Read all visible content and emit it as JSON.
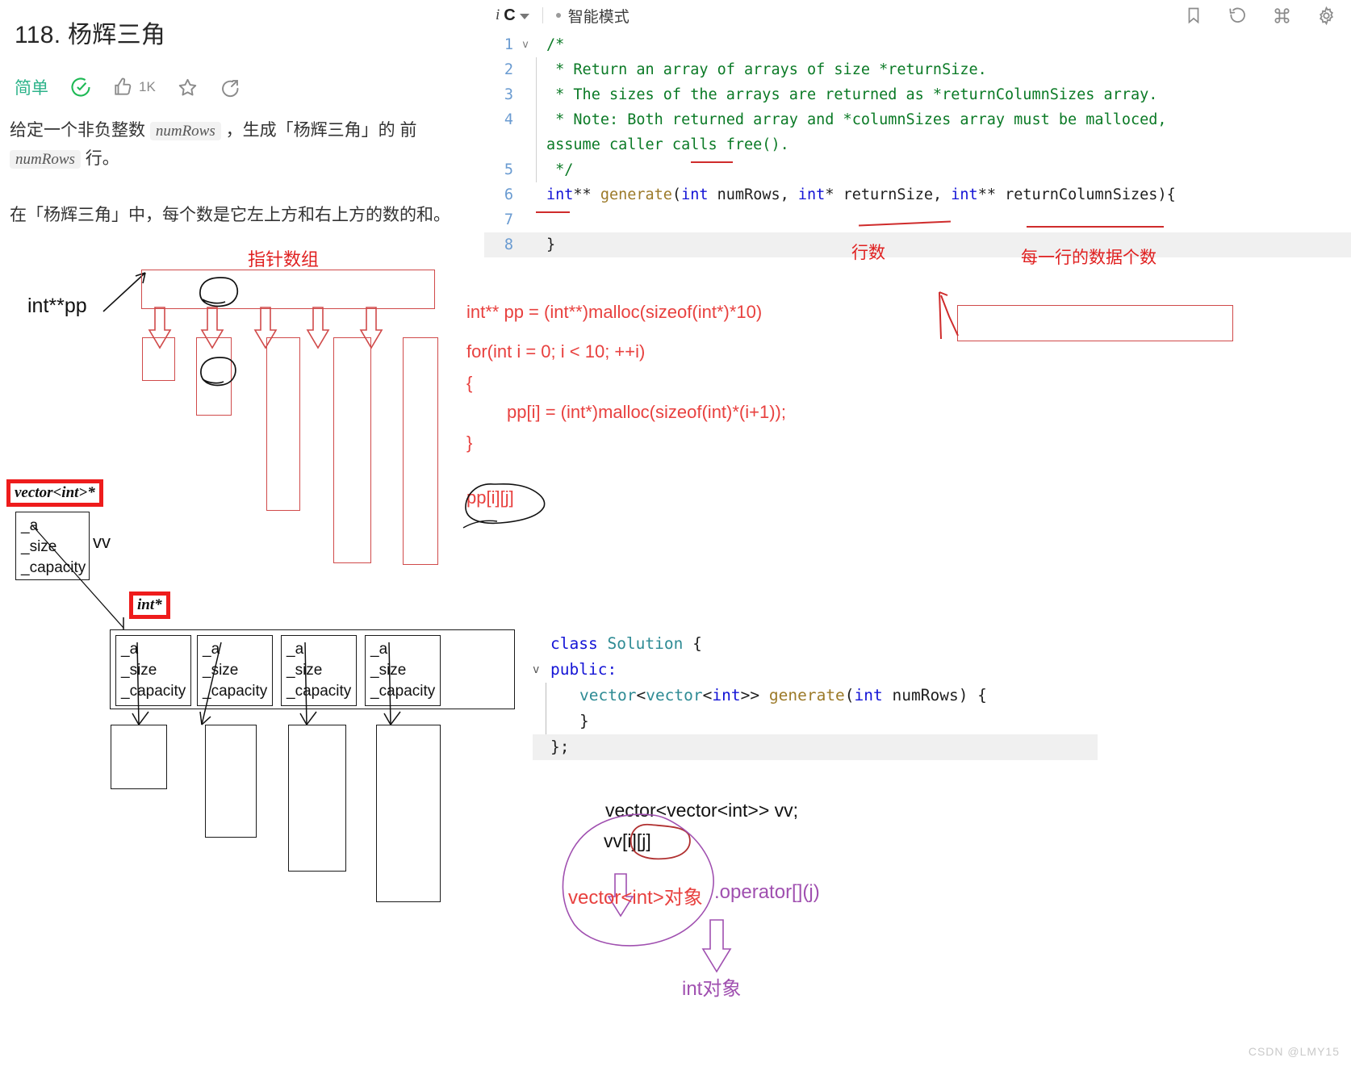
{
  "problem": {
    "title": "118. 杨辉三角",
    "difficulty": "简单",
    "solved_icon": "check-circle-icon",
    "like_icon": "thumbs-up-icon",
    "like_count": "1K",
    "star_icon": "star-icon",
    "share_icon": "share-icon",
    "desc_line1_a": "给定一个非负整数",
    "desc_chip1": "numRows",
    "desc_line1_b": "，生成「杨辉三角」的",
    "desc_line2_a": "前",
    "desc_chip2": "numRows",
    "desc_line2_b": "行。",
    "desc_para2": "在「杨辉三角」中，每个数是它左上方和右上方的数的和。"
  },
  "editor": {
    "lang_prefix": "i",
    "lang_name": "C",
    "chevron_icon": "chevron-down-icon",
    "smart_mode_label": "智能模式",
    "bookmark_icon": "bookmark-icon",
    "reset_icon": "reset-icon",
    "command_icon": "command-icon",
    "settings_icon": "gear-icon",
    "lines": [
      {
        "no": "1",
        "fold": "v",
        "segments": [
          {
            "t": "/*",
            "c": "cmt"
          }
        ]
      },
      {
        "no": "2",
        "fold": "",
        "segments": [
          {
            "t": " * Return an array of arrays of size *returnSize.",
            "c": "cmt"
          }
        ]
      },
      {
        "no": "3",
        "fold": "",
        "segments": [
          {
            "t": " * The sizes of the arrays are returned as *returnColumnSizes array.",
            "c": "cmt"
          }
        ]
      },
      {
        "no": "4",
        "fold": "",
        "segments": [
          {
            "t": " * Note: Both returned array and *columnSizes array must be malloced,",
            "c": "cmt"
          }
        ]
      },
      {
        "no": "",
        "fold": "",
        "segments": [
          {
            "t": "assume caller calls free().",
            "c": "cmt"
          }
        ]
      },
      {
        "no": "5",
        "fold": "",
        "segments": [
          {
            "t": " */",
            "c": "cmt"
          }
        ]
      },
      {
        "no": "6",
        "fold": "",
        "segments": [
          {
            "t": "int",
            "c": "kw"
          },
          {
            "t": "** ",
            "c": "pl"
          },
          {
            "t": "generate",
            "c": "fn"
          },
          {
            "t": "(",
            "c": "pl"
          },
          {
            "t": "int",
            "c": "kw"
          },
          {
            "t": " numRows, ",
            "c": "pl"
          },
          {
            "t": "int",
            "c": "kw"
          },
          {
            "t": "* returnSize, ",
            "c": "pl"
          },
          {
            "t": "int",
            "c": "kw"
          },
          {
            "t": "** returnColumnSizes){",
            "c": "pl"
          }
        ]
      },
      {
        "no": "7",
        "fold": "",
        "segments": [
          {
            "t": "",
            "c": "pl"
          }
        ]
      },
      {
        "no": "8",
        "fold": "",
        "segments": [
          {
            "t": "}",
            "c": "pl"
          }
        ]
      }
    ]
  },
  "annotations": {
    "pointer_array_label": "指针数组",
    "int_pp_label": "int**pp",
    "row_count_label": "行数",
    "per_row_count_label": "每一行的数据个数",
    "vector_int_ptr_tag": "vector<int>*",
    "int_ptr_tag": "int*",
    "vv_label": "vv",
    "struct_fields": [
      "_a",
      "_size",
      "_capacity"
    ],
    "malloc_code": [
      "int** pp = (int**)malloc(sizeof(int*)*10)",
      "for(int i = 0; i < 10; ++i)",
      "{",
      "pp[i] = (int*)malloc(sizeof(int)*(i+1));",
      "}"
    ],
    "pp_index_label": "pp[i][j]",
    "vv_decl": "vector<vector<int>>  vv;",
    "vv_index_label": "vv[i][j]",
    "vector_obj_label": "vector<int>对象",
    "operator_label": ".operator[](j)",
    "int_obj_label": "int对象"
  },
  "cpp_code": {
    "lines": [
      {
        "fold": "",
        "indent": 0,
        "segments": [
          {
            "t": "class ",
            "c": "kw"
          },
          {
            "t": "Solution",
            "c": "cls"
          },
          {
            "t": " {",
            "c": "pl"
          }
        ]
      },
      {
        "fold": "v",
        "indent": 0,
        "segments": [
          {
            "t": "public:",
            "c": "kw"
          }
        ]
      },
      {
        "fold": "",
        "indent": 1,
        "segments": [
          {
            "t": "vector",
            "c": "cls"
          },
          {
            "t": "<",
            "c": "pl"
          },
          {
            "t": "vector",
            "c": "cls"
          },
          {
            "t": "<",
            "c": "pl"
          },
          {
            "t": "int",
            "c": "kw"
          },
          {
            "t": ">> ",
            "c": "pl"
          },
          {
            "t": "generate",
            "c": "fn"
          },
          {
            "t": "(",
            "c": "pl"
          },
          {
            "t": "int",
            "c": "kw"
          },
          {
            "t": " numRows",
            "c": "pl"
          },
          {
            "t": ") {",
            "c": "pl"
          }
        ]
      },
      {
        "fold": "",
        "indent": 0,
        "segments": [
          {
            "t": "",
            "c": "pl"
          }
        ]
      },
      {
        "fold": "",
        "indent": 1,
        "segments": [
          {
            "t": "}",
            "c": "pl"
          }
        ]
      },
      {
        "fold": "",
        "indent": 0,
        "segments": [
          {
            "t": "};",
            "c": "pl"
          }
        ]
      }
    ]
  },
  "watermark": "CSDN @LMY15",
  "colors": {
    "difficulty": "#2db38a",
    "red_pen": "#e02020",
    "purple_pen": "#a050b0",
    "comment_green": "#0b7a26",
    "keyword_blue": "#1414d6"
  }
}
